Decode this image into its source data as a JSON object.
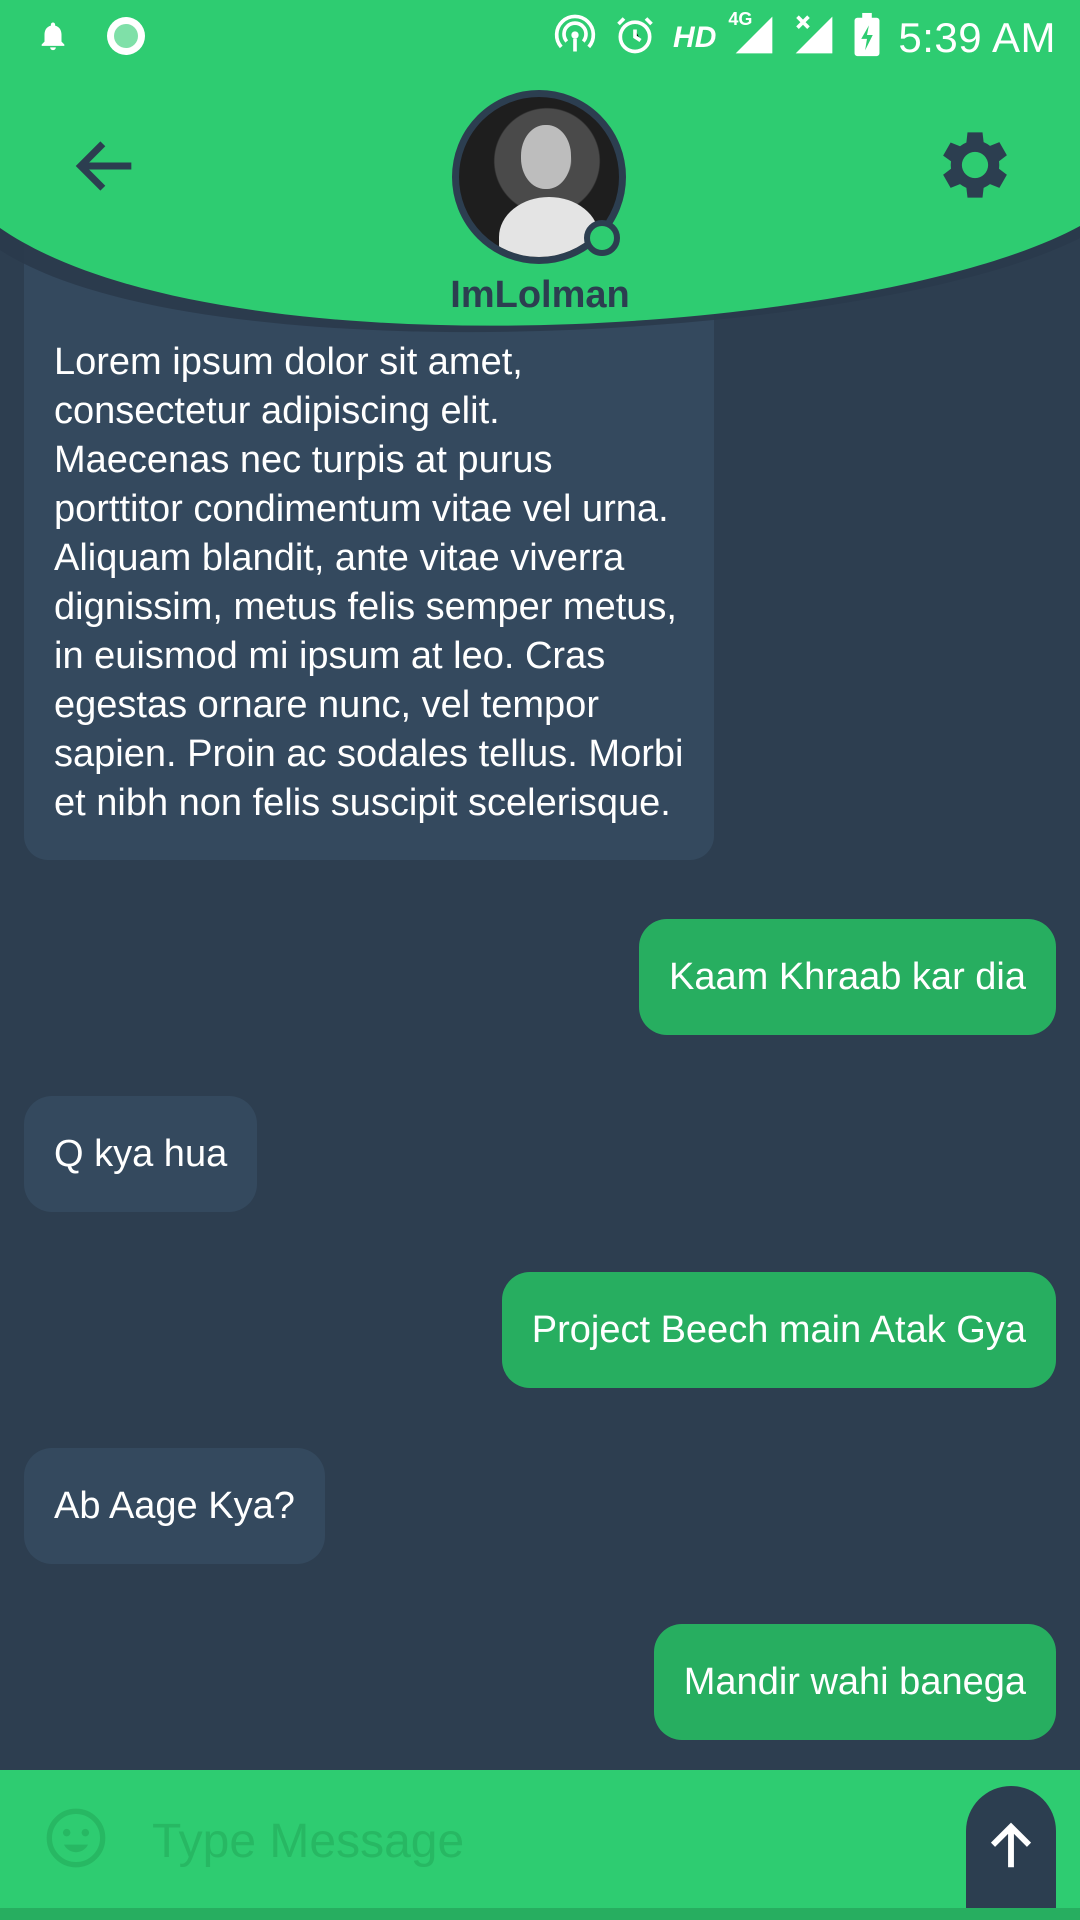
{
  "status_bar": {
    "time": "5:39 AM",
    "hd_label": "HD",
    "network_label": "4G",
    "icons": [
      "notification-bell-icon",
      "circle-app-icon",
      "hotspot-icon",
      "alarm-icon",
      "signal-icon",
      "signal-no-data-icon",
      "battery-charging-icon"
    ]
  },
  "header": {
    "username": "ImLolman",
    "back_icon": "arrow-left-icon",
    "settings_icon": "gear-icon",
    "status": "online",
    "colors": {
      "accent": "#2ecc71",
      "dark": "#2c3e50"
    }
  },
  "messages": [
    {
      "direction": "incoming",
      "text": "Lorem ipsum dolor sit amet, consectetur adipiscing elit. Maecenas nec turpis at purus porttitor condimentum vitae vel urna. Aliquam blandit, ante vitae viverra dignissim, metus felis semper metus, in euismod mi ipsum at leo. Cras egestas ornare nunc, vel tempor sapien. Proin ac sodales tellus. Morbi et nibh non felis suscipit scelerisque."
    },
    {
      "direction": "outgoing",
      "text": "Kaam Khraab kar dia"
    },
    {
      "direction": "incoming",
      "text": "Q kya hua"
    },
    {
      "direction": "outgoing",
      "text": "Project Beech main Atak Gya"
    },
    {
      "direction": "incoming",
      "text": "Ab Aage Kya?"
    },
    {
      "direction": "outgoing",
      "text": "Mandir wahi banega"
    }
  ],
  "composer": {
    "placeholder": "Type Message",
    "value": "",
    "emoji_icon": "smiley-icon",
    "send_icon": "arrow-up-icon"
  },
  "colors": {
    "background": "#2d3e50",
    "incoming_bubble": "#34495e",
    "outgoing_bubble": "#27ae60",
    "header": "#2ecc71"
  }
}
